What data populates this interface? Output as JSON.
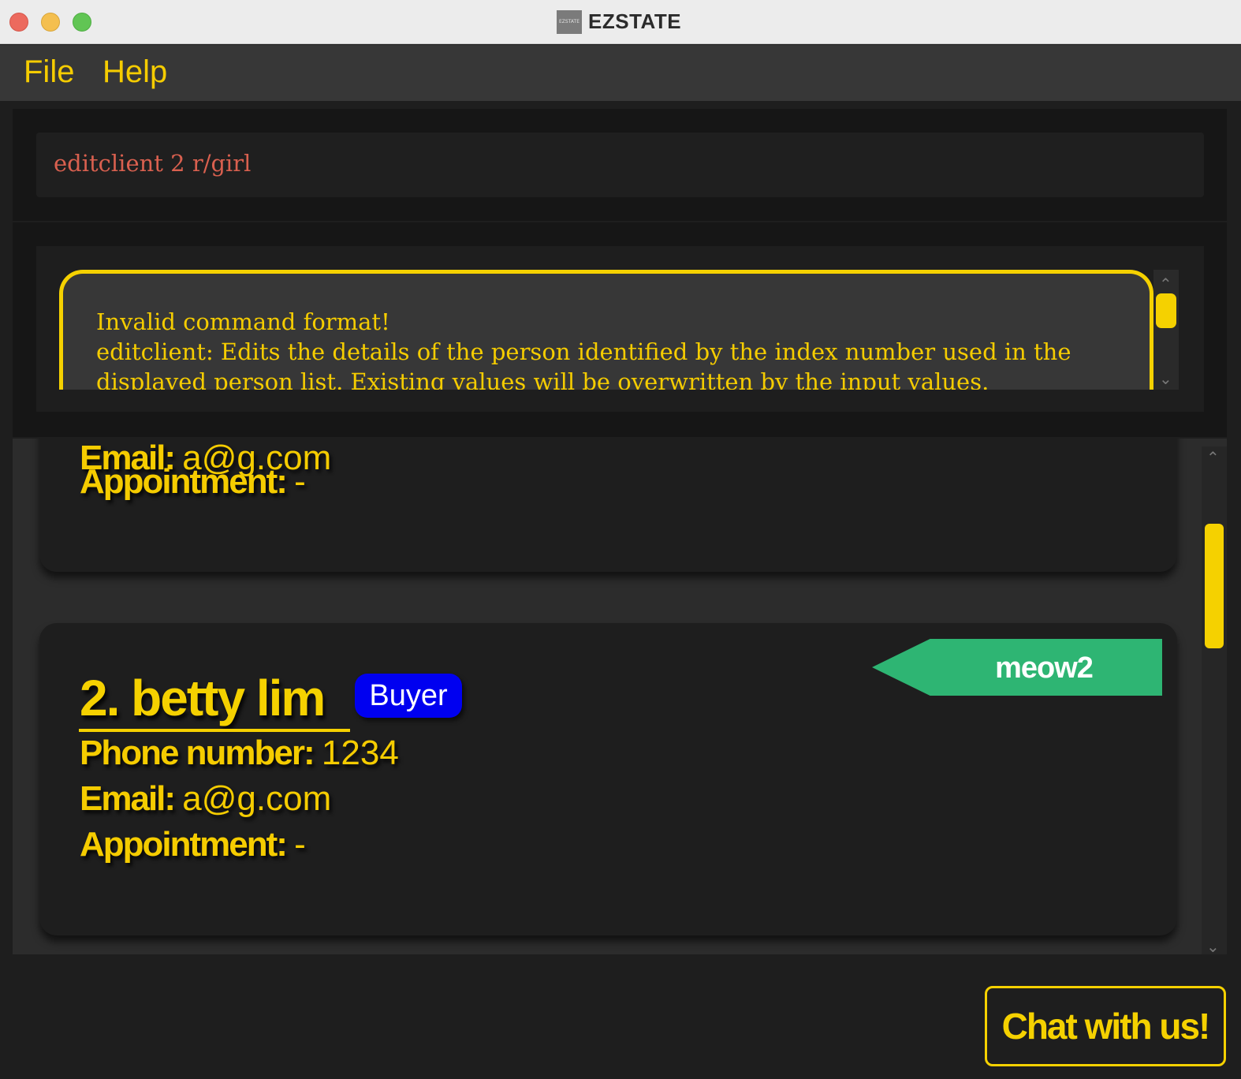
{
  "window": {
    "title": "EZSTATE",
    "icon_text": "EZSTATE"
  },
  "menu": {
    "items": [
      "File",
      "Help"
    ]
  },
  "command": {
    "value": "editclient 2 r/girl"
  },
  "result": {
    "lines": [
      "Invalid command format!",
      "editclient: Edits the details of the person identified by the index number used in the",
      "displayed person list. Existing values will be overwritten by the input values."
    ]
  },
  "clients": [
    {
      "partial_email_label": "Email:",
      "partial_email_value": "a@g.com",
      "appointment_label": "Appointment:",
      "appointment_value": "-"
    },
    {
      "index_name": "2. betty lim",
      "role": "Buyer",
      "tag": "meow2",
      "phone_label": "Phone number:",
      "phone_value": "1234",
      "email_label": "Email:",
      "email_value": "a@g.com",
      "appointment_label": "Appointment:",
      "appointment_value": "-"
    }
  ],
  "colors": {
    "accent": "#f5d100",
    "role_badge": "#0000f0",
    "tag": "#2eb573",
    "error_text": "#d9604f"
  },
  "chat_button": {
    "label": "Chat with us!"
  }
}
